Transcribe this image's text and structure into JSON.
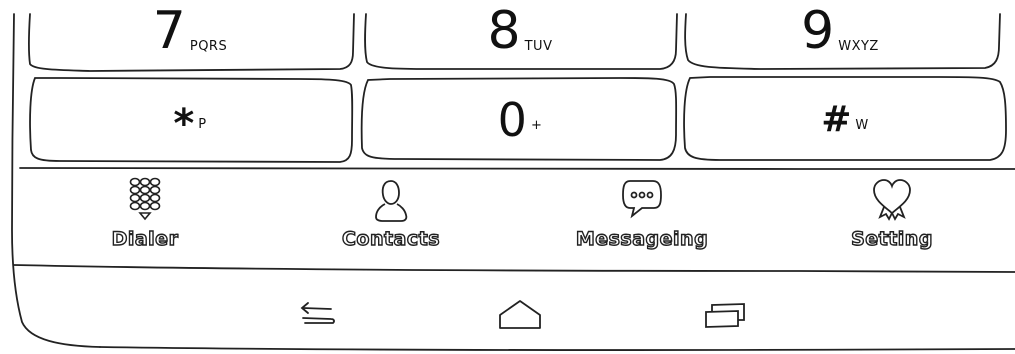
{
  "dialpad": {
    "rows": [
      [
        {
          "digit": "7",
          "letters": "PQRS"
        },
        {
          "digit": "8",
          "letters": "TUV"
        },
        {
          "digit": "9",
          "letters": "WXYZ"
        }
      ],
      [
        {
          "digit": "*",
          "letters": "P"
        },
        {
          "digit": "0",
          "letters": "+"
        },
        {
          "digit": "#",
          "letters": "W"
        }
      ]
    ]
  },
  "tabs": [
    {
      "label": "Dialer",
      "icon": "dialpad-icon"
    },
    {
      "label": "Contacts",
      "icon": "contact-person-icon"
    },
    {
      "label": "Messageing",
      "icon": "message-bubble-icon"
    },
    {
      "label": "Setting",
      "icon": "heart-icon"
    }
  ],
  "navbar": {
    "buttons": [
      "back-icon",
      "home-icon",
      "recent-apps-icon"
    ]
  },
  "colors": {
    "ink": "#111111",
    "background": "#ffffff"
  }
}
